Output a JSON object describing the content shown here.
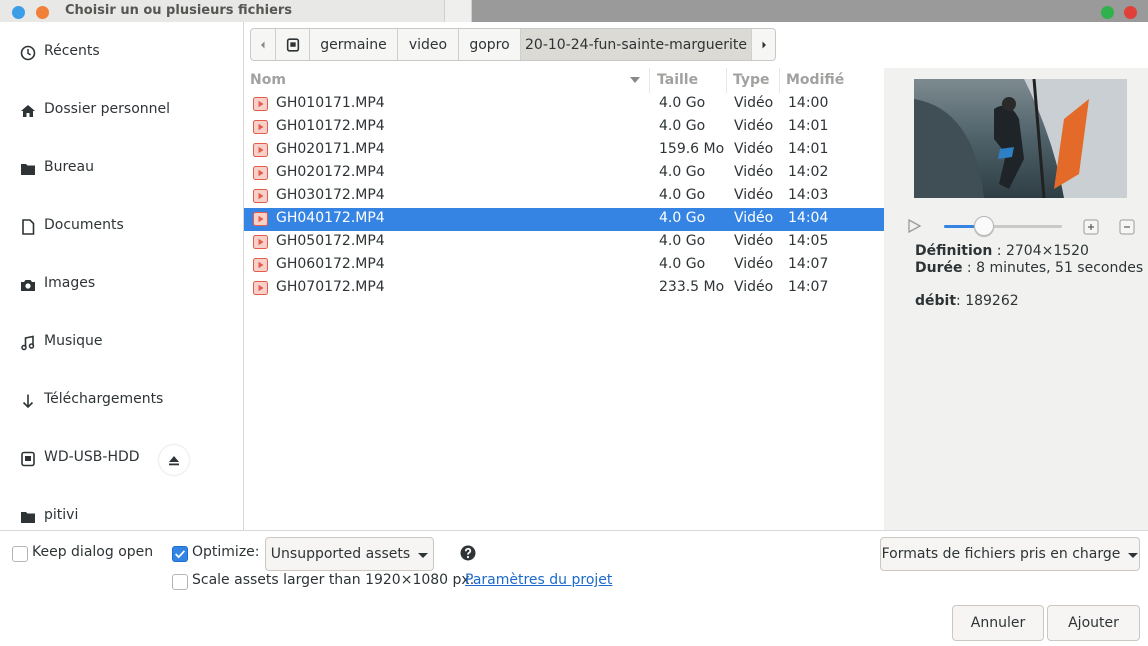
{
  "window": {
    "title": "Choisir un ou plusieurs fichiers"
  },
  "sidebar": {
    "items": [
      {
        "label": "Récents",
        "icon": "clock-icon"
      },
      {
        "label": "Dossier personnel",
        "icon": "home-icon"
      },
      {
        "label": "Bureau",
        "icon": "folder-icon"
      },
      {
        "label": "Documents",
        "icon": "document-icon"
      },
      {
        "label": "Images",
        "icon": "camera-icon"
      },
      {
        "label": "Musique",
        "icon": "music-note-icon"
      },
      {
        "label": "Téléchargements",
        "icon": "download-arrow-icon"
      },
      {
        "label": "WD-USB-HDD",
        "icon": "drive-icon"
      },
      {
        "label": "pitivi",
        "icon": "folder-icon"
      }
    ]
  },
  "pathbar": {
    "segments": [
      "germaine",
      "video",
      "gopro",
      "20-10-24-fun-sainte-marguerite"
    ]
  },
  "filelist": {
    "columns": {
      "name": "Nom",
      "size": "Taille",
      "type": "Type",
      "modified": "Modifié"
    },
    "selected_index": 5,
    "rows": [
      {
        "name": "GH010171.MP4",
        "size": "4.0 Go",
        "type": "Vidéo",
        "modified": "14:00"
      },
      {
        "name": "GH010172.MP4",
        "size": "4.0 Go",
        "type": "Vidéo",
        "modified": "14:01"
      },
      {
        "name": "GH020171.MP4",
        "size": "159.6 Mo",
        "type": "Vidéo",
        "modified": "14:01"
      },
      {
        "name": "GH020172.MP4",
        "size": "4.0 Go",
        "type": "Vidéo",
        "modified": "14:02"
      },
      {
        "name": "GH030172.MP4",
        "size": "4.0 Go",
        "type": "Vidéo",
        "modified": "14:03"
      },
      {
        "name": "GH040172.MP4",
        "size": "4.0 Go",
        "type": "Vidéo",
        "modified": "14:04"
      },
      {
        "name": "GH050172.MP4",
        "size": "4.0 Go",
        "type": "Vidéo",
        "modified": "14:05"
      },
      {
        "name": "GH060172.MP4",
        "size": "4.0 Go",
        "type": "Vidéo",
        "modified": "14:07"
      },
      {
        "name": "GH070172.MP4",
        "size": "233.5 Mo",
        "type": "Vidéo",
        "modified": "14:07"
      }
    ]
  },
  "preview": {
    "slider_fraction": 0.34,
    "definition_label": "Définition",
    "definition_value": "2704×1520",
    "duration_label": "Durée",
    "duration_value": "8 minutes, 51 secondes",
    "bitrate_label": "débit",
    "bitrate_value": "189262"
  },
  "footer": {
    "keep_open_label": "Keep dialog open",
    "keep_open_checked": false,
    "optimize_label": "Optimize:",
    "optimize_checked": true,
    "optimize_select": "Unsupported assets",
    "scale_label": "Scale assets larger than 1920×1080 px.",
    "scale_checked": false,
    "project_settings_link": "Paramètres du projet",
    "formats_select": "Formats de fichiers pris en charge",
    "cancel_label": "Annuler",
    "add_label": "Ajouter"
  },
  "colors": {
    "accent": "#3584e4",
    "close": "#e0403a",
    "minimize": "#f0803a",
    "maximize": "#2fb14b",
    "video_icon": "#e35d4a"
  }
}
